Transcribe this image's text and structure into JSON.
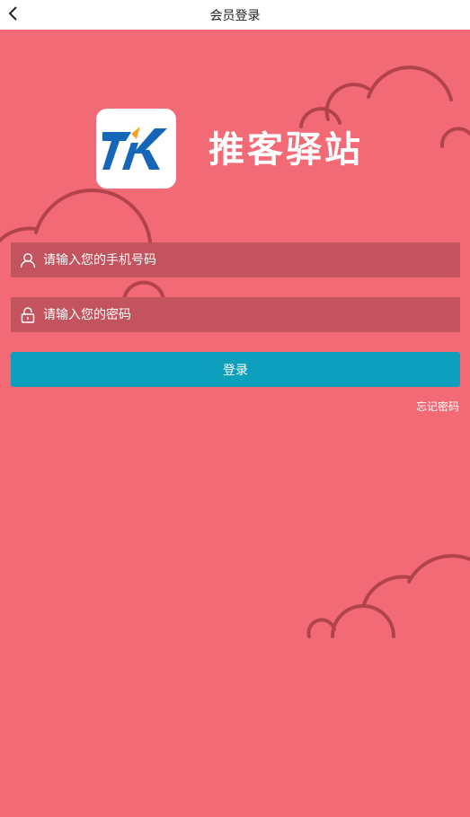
{
  "header": {
    "title": "会员登录",
    "back_icon": "chevron-left-icon"
  },
  "brand": {
    "name": "推客驿站",
    "logo_letter": "K"
  },
  "form": {
    "phone_placeholder": "请输入您的手机号码",
    "phone_value": "",
    "phone_icon": "user-icon",
    "password_placeholder": "请输入您的密码",
    "password_value": "",
    "password_icon": "lock-icon",
    "login_label": "登录",
    "forgot_label": "忘记密码"
  },
  "colors": {
    "background": "#f26a75",
    "input_bg": "#c3535c",
    "button_bg": "#0e9fbd",
    "cloud_stroke": "#b2434c",
    "logo_blue": "#1565b8",
    "logo_orange": "#f5a623"
  }
}
